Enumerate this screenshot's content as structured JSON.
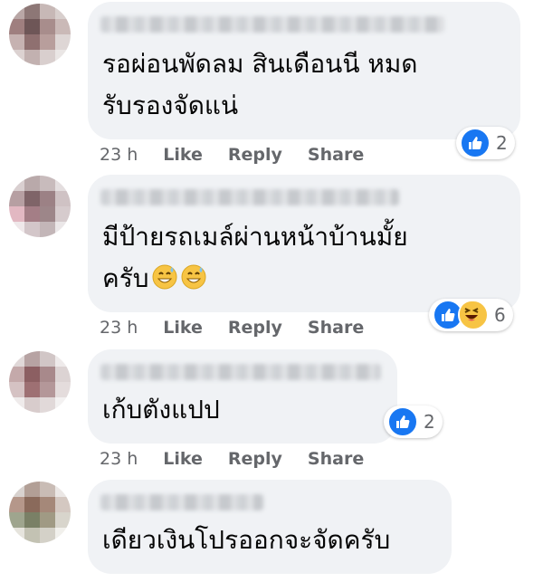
{
  "comments": [
    {
      "text": "รอผ่อนพัดลม สินเดือนนี หมด\nรับรองจัดแน่",
      "time": "23 h",
      "like_label": "Like",
      "reply_label": "Reply",
      "share_label": "Share",
      "reaction_count": "2",
      "reaction_icons": [
        "like-icon"
      ]
    },
    {
      "text": "มีป้ายรถเมล์ผ่านหน้าบ้านมั้ย\nครับ",
      "time": "23 h",
      "like_label": "Like",
      "reply_label": "Reply",
      "share_label": "Share",
      "reaction_count": "6",
      "reaction_icons": [
        "like-icon",
        "haha-icon"
      ]
    },
    {
      "text": "เก้บตังแปป",
      "time": "23 h",
      "like_label": "Like",
      "reply_label": "Reply",
      "share_label": "Share",
      "reaction_count": "2",
      "reaction_icons": [
        "like-icon"
      ]
    },
    {
      "text": "เดียวเงินโปรออกจะจัดครับ"
    }
  ],
  "colors": {
    "bubble": "#f0f2f5",
    "like_blue": "#1877f2",
    "meta_gray": "#65676b",
    "text": "#050505"
  }
}
